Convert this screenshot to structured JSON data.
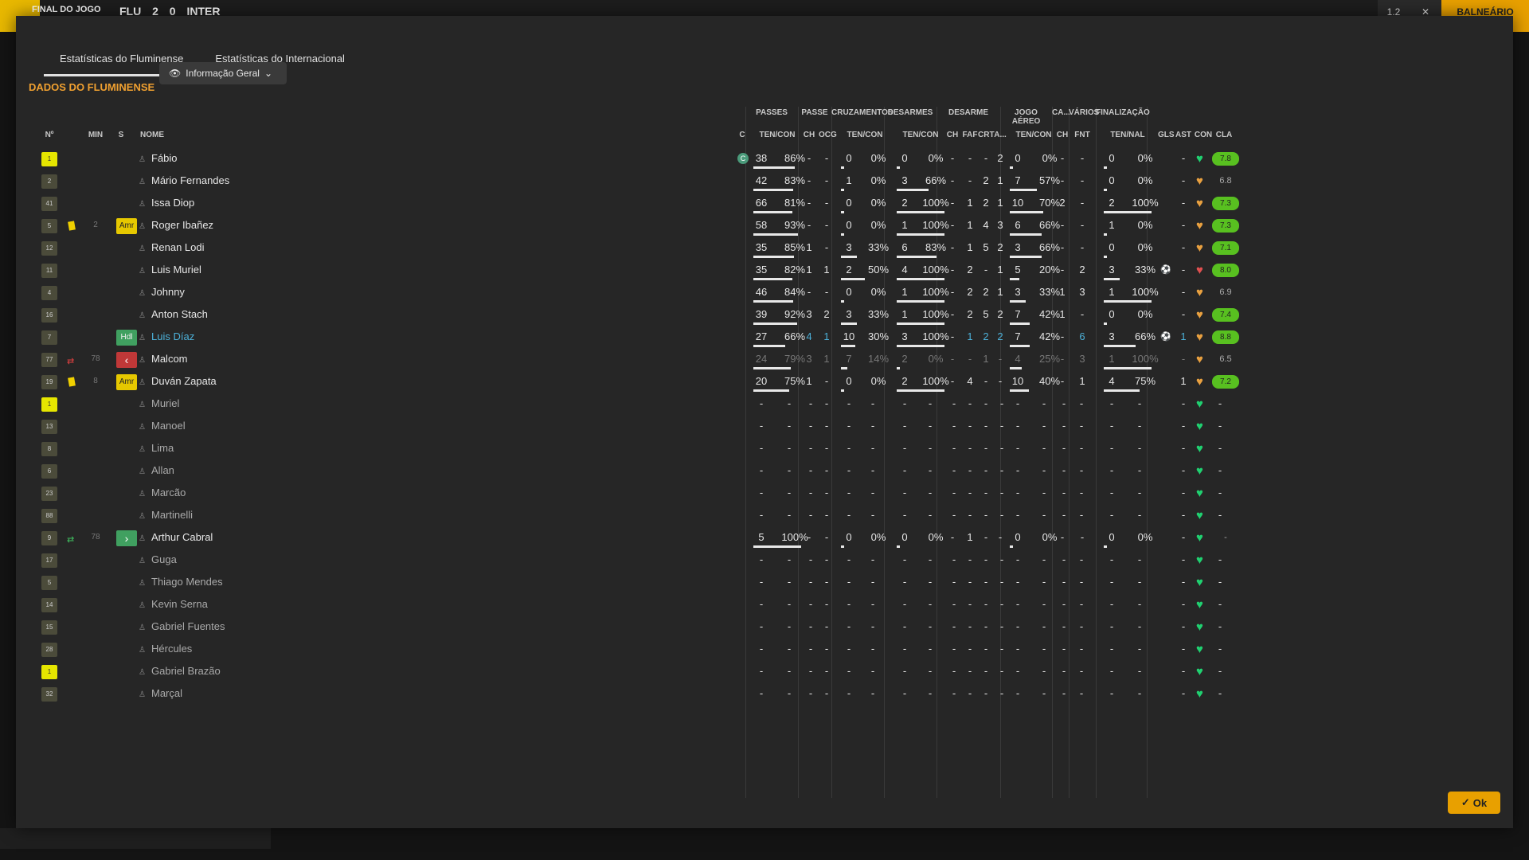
{
  "topbar": {
    "result_label": "FINAL DO JOGO",
    "home": "FLU",
    "score_home": "2",
    "score_away": "0",
    "away": "INTER",
    "zoom": "1.2",
    "right_button": "BALNEÁRIO",
    "close": "✕"
  },
  "tabs": [
    {
      "label": "Estatísticas do Fluminense"
    },
    {
      "label": "Estatísticas do Internacional"
    }
  ],
  "section": {
    "title": "DADOS DO FLUMINENSE",
    "view": "Informação Geral"
  },
  "group_headers": [
    "PASSES",
    "PASSE",
    "CRUZAMENTOS",
    "DESARMES",
    "DESARME",
    "JOGO AÉREO",
    "CA...",
    "VÁRIOS",
    "FINALIZAÇÃO"
  ],
  "sub_headers": {
    "no": "Nº",
    "min": "MIN",
    "s": "S",
    "nome": "NOME",
    "c": "C",
    "passes": "TEN/CON",
    "passe_ch": "CH",
    "passe_ocg": "OCG",
    "cruz": "TEN/CON",
    "des": "TEN/CON",
    "d_ch": "CH",
    "d_faf": "FAF",
    "d_crt": "CRT",
    "d_a": "A...",
    "aereo": "TEN/CON",
    "ca_ch": "CH",
    "fnt": "FNT",
    "fin": "TEN/NAL",
    "gls": "GLS",
    "ast": "AST",
    "con": "CON",
    "cla": "CLA"
  },
  "colors": {
    "accent": "#f0a030",
    "link": "#4cb0d8",
    "heart_green": "#20d070",
    "heart_orange": "#e8a040",
    "rating_green": "#58c020",
    "rating_light": "#70c830"
  },
  "rows": [
    {
      "num": "1",
      "gk": true,
      "name": "Fábio",
      "captain": "C",
      "p": [
        "38",
        "86%"
      ],
      "pf": 0.86,
      "ch": "-",
      "ocg": "-",
      "cr": [
        "0",
        "0%"
      ],
      "cf": 0,
      "de": [
        "0",
        "0%"
      ],
      "df": 0,
      "dch": "-",
      "faf": "-",
      "crt": "-",
      "a": "2",
      "ae": [
        "0",
        "0%"
      ],
      "af": 0,
      "cach": "-",
      "fnt": "-",
      "fi": [
        "0",
        "0%"
      ],
      "ff": 0,
      "gls": "",
      "ast": "-",
      "con": "green",
      "cla": "7.8",
      "cla_hi": true
    },
    {
      "num": "2",
      "name": "Mário Fernandes",
      "p": [
        "42",
        "83%"
      ],
      "pf": 0.83,
      "ch": "-",
      "ocg": "-",
      "cr": [
        "1",
        "0%"
      ],
      "cf": 0,
      "de": [
        "3",
        "66%"
      ],
      "df": 0.66,
      "dch": "-",
      "faf": "-",
      "crt": "2",
      "a": "1",
      "ae": [
        "7",
        "57%"
      ],
      "af": 0.57,
      "cach": "-",
      "fnt": "-",
      "fi": [
        "0",
        "0%"
      ],
      "ff": 0,
      "gls": "",
      "ast": "-",
      "con": "orange",
      "cla": "6.8",
      "cla_hi": false
    },
    {
      "num": "41",
      "name": "Issa Diop",
      "p": [
        "66",
        "81%"
      ],
      "pf": 0.81,
      "ch": "-",
      "ocg": "-",
      "cr": [
        "0",
        "0%"
      ],
      "cf": 0,
      "de": [
        "2",
        "100%"
      ],
      "df": 1,
      "dch": "-",
      "faf": "1",
      "crt": "2",
      "a": "1",
      "ae": [
        "10",
        "70%"
      ],
      "af": 0.7,
      "cach": "2",
      "fnt": "-",
      "fi": [
        "2",
        "100%"
      ],
      "ff": 1,
      "gls": "",
      "ast": "-",
      "con": "orange",
      "cla": "7.3",
      "cla_hi": true
    },
    {
      "num": "5",
      "card": true,
      "min": "2",
      "pos": "Amr",
      "pos_type": "amr",
      "name": "Roger Ibañez",
      "p": [
        "58",
        "93%"
      ],
      "pf": 0.93,
      "ch": "-",
      "ocg": "-",
      "cr": [
        "0",
        "0%"
      ],
      "cf": 0,
      "de": [
        "1",
        "100%"
      ],
      "df": 1,
      "dch": "-",
      "faf": "1",
      "crt": "4",
      "a": "3",
      "ae": [
        "6",
        "66%"
      ],
      "af": 0.66,
      "cach": "-",
      "fnt": "-",
      "fi": [
        "1",
        "0%"
      ],
      "ff": 0,
      "gls": "",
      "ast": "-",
      "con": "orange",
      "cla": "7.3",
      "cla_hi": true
    },
    {
      "num": "12",
      "name": "Renan Lodi",
      "p": [
        "35",
        "85%"
      ],
      "pf": 0.85,
      "ch": "1",
      "ocg": "-",
      "cr": [
        "3",
        "33%"
      ],
      "cf": 0.33,
      "de": [
        "6",
        "83%"
      ],
      "df": 0.83,
      "dch": "-",
      "faf": "1",
      "crt": "5",
      "a": "2",
      "ae": [
        "3",
        "66%"
      ],
      "af": 0.66,
      "cach": "-",
      "fnt": "-",
      "fi": [
        "0",
        "0%"
      ],
      "ff": 0,
      "gls": "",
      "ast": "-",
      "con": "orange",
      "cla": "7.1",
      "cla_hi": true
    },
    {
      "num": "11",
      "name": "Luis Muriel",
      "p": [
        "35",
        "82%"
      ],
      "pf": 0.82,
      "ch": "1",
      "ocg": "1",
      "cr": [
        "2",
        "50%"
      ],
      "cf": 0.5,
      "de": [
        "4",
        "100%"
      ],
      "df": 1,
      "dch": "-",
      "faf": "2",
      "crt": "-",
      "a": "1",
      "ae": [
        "5",
        "20%"
      ],
      "af": 0.2,
      "cach": "-",
      "fnt": "2",
      "fi": [
        "3",
        "33%"
      ],
      "ff": 0.33,
      "gls": "ball",
      "ast": "-",
      "con": "red",
      "cla": "8.0",
      "cla_hi": true
    },
    {
      "num": "4",
      "name": "Johnny",
      "p": [
        "46",
        "84%"
      ],
      "pf": 0.84,
      "ch": "-",
      "ocg": "-",
      "cr": [
        "0",
        "0%"
      ],
      "cf": 0,
      "de": [
        "1",
        "100%"
      ],
      "df": 1,
      "dch": "-",
      "faf": "2",
      "crt": "2",
      "a": "1",
      "ae": [
        "3",
        "33%"
      ],
      "af": 0.33,
      "cach": "1",
      "fnt": "3",
      "fi": [
        "1",
        "100%"
      ],
      "ff": 1,
      "gls": "",
      "ast": "-",
      "con": "orange",
      "cla": "6.9",
      "cla_hi": false
    },
    {
      "num": "16",
      "name": "Anton Stach",
      "p": [
        "39",
        "92%"
      ],
      "pf": 0.92,
      "ch": "3",
      "ocg": "2",
      "cr": [
        "3",
        "33%"
      ],
      "cf": 0.33,
      "de": [
        "1",
        "100%"
      ],
      "df": 1,
      "dch": "-",
      "faf": "2",
      "crt": "5",
      "a": "2",
      "ae": [
        "7",
        "42%"
      ],
      "af": 0.42,
      "cach": "1",
      "fnt": "-",
      "fi": [
        "0",
        "0%"
      ],
      "ff": 0,
      "gls": "",
      "ast": "-",
      "con": "orange",
      "cla": "7.4",
      "cla_hi": true
    },
    {
      "num": "7",
      "pos": "Hdl",
      "pos_type": "hdl",
      "name": "Luis Díaz",
      "link": true,
      "p": [
        "27",
        "66%"
      ],
      "pf": 0.66,
      "ch": "4",
      "ocg": "1",
      "cr": [
        "10",
        "30%"
      ],
      "cf": 0.3,
      "de": [
        "3",
        "100%"
      ],
      "df": 1,
      "dch": "-",
      "faf": "1",
      "crt": "2",
      "a": "2",
      "ae": [
        "7",
        "42%"
      ],
      "af": 0.42,
      "cach": "-",
      "fnt": "6",
      "fi": [
        "3",
        "66%"
      ],
      "ff": 0.66,
      "gls": "ball",
      "ast": "1",
      "con": "orange",
      "cla": "8.8",
      "cla_hi": true,
      "blue": true
    },
    {
      "num": "77",
      "subout": true,
      "min": "78",
      "pos": "‹",
      "pos_type": "out",
      "name": "Malcom",
      "p": [
        "24",
        "79%"
      ],
      "pf": 0.79,
      "ch": "3",
      "ocg": "1",
      "cr": [
        "7",
        "14%"
      ],
      "cf": 0.14,
      "de": [
        "2",
        "0%"
      ],
      "df": 0,
      "dch": "-",
      "faf": "-",
      "crt": "1",
      "a": "-",
      "ae": [
        "4",
        "25%"
      ],
      "af": 0.25,
      "cach": "-",
      "fnt": "3",
      "fi": [
        "1",
        "100%"
      ],
      "ff": 1,
      "gls": "",
      "ast": "-",
      "con": "orange",
      "cla": "6.5",
      "cla_hi": false,
      "dim": true
    },
    {
      "num": "19",
      "card": true,
      "min": "8",
      "pos": "Amr",
      "pos_type": "amr",
      "name": "Duván Zapata",
      "p": [
        "20",
        "75%"
      ],
      "pf": 0.75,
      "ch": "1",
      "ocg": "-",
      "cr": [
        "0",
        "0%"
      ],
      "cf": 0,
      "de": [
        "2",
        "100%"
      ],
      "df": 1,
      "dch": "-",
      "faf": "4",
      "crt": "-",
      "a": "-",
      "ae": [
        "10",
        "40%"
      ],
      "af": 0.4,
      "cach": "-",
      "fnt": "1",
      "fi": [
        "4",
        "75%"
      ],
      "ff": 0.75,
      "gls": "",
      "ast": "1",
      "con": "orange",
      "cla": "7.2",
      "cla_hi": true
    },
    {
      "num": "1",
      "gk": true,
      "name": "Muriel",
      "empty": true,
      "con": "green"
    },
    {
      "num": "13",
      "name": "Manoel",
      "empty": true,
      "con": "green"
    },
    {
      "num": "8",
      "name": "Lima",
      "empty": true,
      "con": "green"
    },
    {
      "num": "6",
      "name": "Allan",
      "empty": true,
      "con": "green"
    },
    {
      "num": "23",
      "name": "Marcão",
      "empty": true,
      "con": "green"
    },
    {
      "num": "88",
      "name": "Martinelli",
      "empty": true,
      "con": "green"
    },
    {
      "num": "9",
      "subin": true,
      "min": "78",
      "pos": "›",
      "pos_type": "in",
      "name": "Arthur Cabral",
      "p": [
        "5",
        "100%"
      ],
      "pf": 1,
      "ch": "-",
      "ocg": "-",
      "cr": [
        "0",
        "0%"
      ],
      "cf": 0,
      "de": [
        "0",
        "0%"
      ],
      "df": 0,
      "dch": "-",
      "faf": "1",
      "crt": "-",
      "a": "-",
      "ae": [
        "0",
        "0%"
      ],
      "af": 0,
      "cach": "-",
      "fnt": "-",
      "fi": [
        "0",
        "0%"
      ],
      "ff": 0,
      "gls": "",
      "ast": "-",
      "con": "green",
      "cla": "-",
      "cla_hi": false
    },
    {
      "num": "17",
      "name": "Guga",
      "empty": true,
      "con": "green"
    },
    {
      "num": "5",
      "name": "Thiago Mendes",
      "empty": true,
      "con": "green"
    },
    {
      "num": "14",
      "name": "Kevin Serna",
      "empty": true,
      "con": "green"
    },
    {
      "num": "15",
      "name": "Gabriel Fuentes",
      "empty": true,
      "con": "green"
    },
    {
      "num": "28",
      "name": "Hércules",
      "empty": true,
      "con": "green"
    },
    {
      "num": "1",
      "gk": true,
      "name": "Gabriel Brazão",
      "empty": true,
      "con": "green"
    },
    {
      "num": "32",
      "name": "Marçal",
      "empty": true,
      "con": "green"
    }
  ],
  "ok_button": "Ok"
}
